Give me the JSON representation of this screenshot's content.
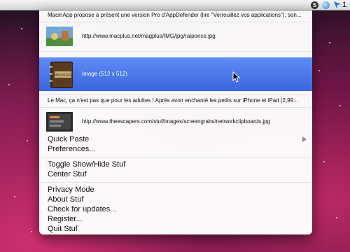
{
  "menubar": {
    "s_icon": "S",
    "status_count": "1"
  },
  "menu": {
    "top_text": "MacinApp propose à présent une version Pro d'AppDefender (lire \"Verrouillez vos applications\"), son...",
    "clip1_url": "http://www.macplus.net/magplus/IMG/jpg/raiponce.jpg",
    "selected_label": "Image (512 x 512)",
    "book_title": "INVOICES",
    "text2": "Le Mac, ça n'est pas que pour les adultes ! Après avoir enchanté les petits sur iPhone et iPad (2,99...",
    "clip3_url": "http://www.theescapers.com/stuf/images/screengrabs/networkclipboards.jpg",
    "items": {
      "quick_paste": "Quick Paste",
      "preferences": "Preferences...",
      "toggle": "Toggle Show/Hide Stuf",
      "center": "Center Stuf",
      "privacy": "Privacy Mode",
      "about": "About Stuf",
      "updates": "Check for updates...",
      "register": "Register...",
      "quit": "Quit Stuf"
    }
  },
  "colors": {
    "selection": "#3d6ae6",
    "menu_bg": "#ffffff"
  }
}
